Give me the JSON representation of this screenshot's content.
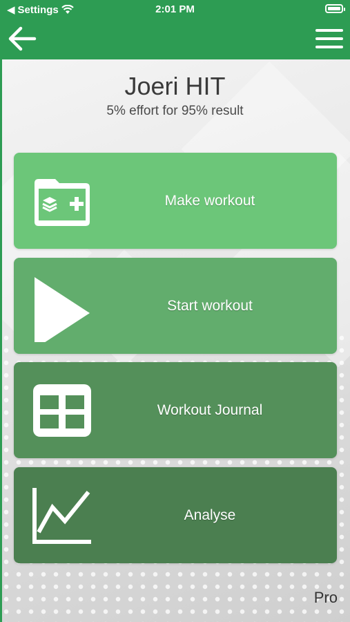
{
  "status_bar": {
    "back_app": "Settings",
    "time": "2:01 PM"
  },
  "header": {
    "back_icon": "arrow-left-icon",
    "menu_icon": "hamburger-menu-icon"
  },
  "app": {
    "title": "Joeri HIT",
    "subtitle": "5% effort for 95% result"
  },
  "menu_items": [
    {
      "label": "Make workout",
      "icon": "folder-add-icon",
      "color": "#6cc679"
    },
    {
      "label": "Start workout",
      "icon": "play-icon",
      "color": "#62ad6d"
    },
    {
      "label": "Workout Journal",
      "icon": "table-grid-icon",
      "color": "#54905a"
    },
    {
      "label": "Analyse",
      "icon": "line-chart-icon",
      "color": "#4b7f50"
    }
  ],
  "footer": {
    "pro_label": "Pro"
  },
  "colors": {
    "header": "#2d9c53"
  }
}
